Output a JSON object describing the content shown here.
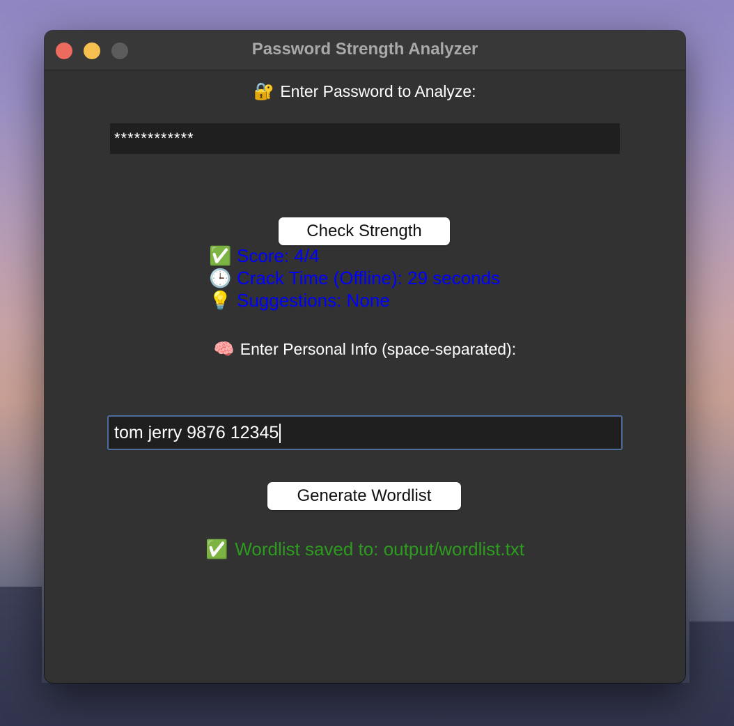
{
  "window": {
    "title": "Password Strength Analyzer"
  },
  "password_section": {
    "icon": "lock-key-emoji",
    "icon_glyph": "🔐",
    "label": "Enter Password to Analyze:",
    "value": "************"
  },
  "check_button": {
    "label": "Check Strength"
  },
  "results": {
    "color": "#0000ff",
    "score": {
      "icon": "check-mark-emoji",
      "glyph": "✅",
      "text": "Score: 4/4"
    },
    "crack_time": {
      "icon": "clock-emoji",
      "glyph": "🕒",
      "text": "Crack Time (Offline): 29 seconds"
    },
    "suggestions": {
      "icon": "light-bulb-emoji",
      "glyph": "💡",
      "text": "Suggestions: None"
    }
  },
  "personal_info": {
    "icon": "brain-emoji",
    "icon_glyph": "🧠",
    "label": "Enter Personal Info (space-separated):",
    "value": "tom jerry 9876 12345"
  },
  "generate_button": {
    "label": "Generate Wordlist"
  },
  "status": {
    "icon": "check-mark-emoji",
    "glyph": "✅",
    "text": "Wordlist saved to: output/wordlist.txt",
    "color": "#2d9b1f"
  },
  "colors": {
    "window_bg": "#323232",
    "field_bg": "#1f1f1f",
    "focus_border": "#4d6d9c",
    "close": "#ed6a5e",
    "minimize": "#f5c04f",
    "zoom": "#5c5c5c"
  }
}
